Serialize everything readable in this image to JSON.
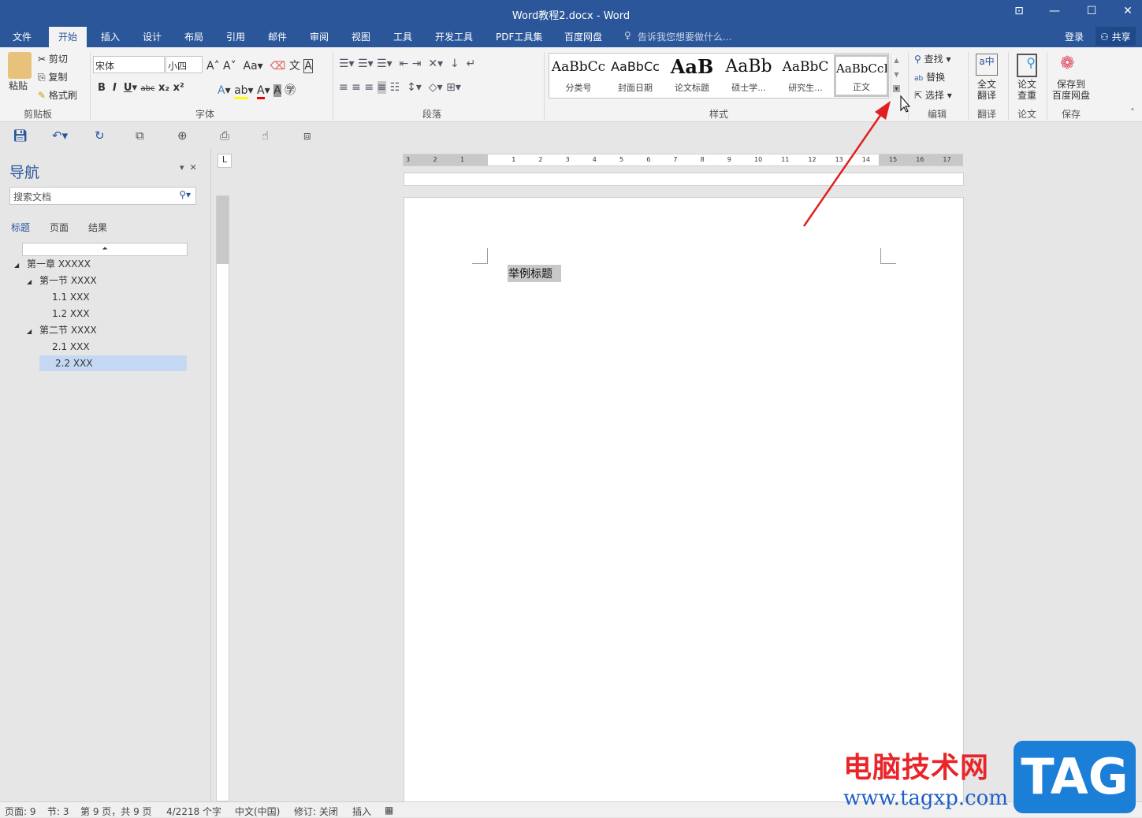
{
  "window": {
    "title": "Word教程2.docx - Word",
    "controls": [
      "restore-ribbon",
      "minimize",
      "maximize",
      "close"
    ]
  },
  "tabs": [
    "文件",
    "开始",
    "插入",
    "设计",
    "布局",
    "引用",
    "邮件",
    "审阅",
    "视图",
    "工具",
    "开发工具",
    "PDF工具集",
    "百度网盘"
  ],
  "active_tab": "开始",
  "tell_me": "告诉我您想要做什么...",
  "login": "登录",
  "share": "共享",
  "ribbon": {
    "clipboard": {
      "paste": "粘贴",
      "cut": "剪切",
      "copy": "复制",
      "format_painter": "格式刷",
      "group": "剪贴板"
    },
    "font": {
      "font_name": "宋体",
      "font_size": "小四",
      "group": "字体"
    },
    "paragraph": {
      "group": "段落"
    },
    "styles": {
      "items": [
        {
          "sample": "AaBbCc",
          "label": "分类号"
        },
        {
          "sample": "AaBbCc",
          "label": "封面日期"
        },
        {
          "sample": "AaB",
          "label": "论文标题"
        },
        {
          "sample": "AaBb",
          "label": "硕士学..."
        },
        {
          "sample": "AaBbC",
          "label": "研究生..."
        },
        {
          "sample": "AaBbCcI",
          "label": "正文"
        }
      ],
      "group": "样式",
      "selected": "正文"
    },
    "editing": {
      "find": "查找",
      "replace": "替换",
      "select": "选择",
      "group": "编辑"
    },
    "translate": {
      "label1": "全文",
      "label2": "翻译",
      "group": "翻译"
    },
    "paper": {
      "label1": "论文",
      "label2": "查重",
      "group": "论文"
    },
    "save": {
      "label1": "保存到",
      "label2": "百度网盘",
      "group": "保存"
    }
  },
  "nav": {
    "title": "导航",
    "search_placeholder": "搜索文档",
    "tabs": [
      "标题",
      "页面",
      "结果"
    ],
    "active_tab": "标题",
    "tree": [
      {
        "text": "第一章 XXXXX",
        "level": 0,
        "expanded": true
      },
      {
        "text": "第一节 XXXX",
        "level": 1,
        "expanded": true
      },
      {
        "text": "1.1 XXX",
        "level": 2
      },
      {
        "text": "1.2 XXX",
        "level": 2
      },
      {
        "text": "第二节 XXXX",
        "level": 1,
        "expanded": true
      },
      {
        "text": "2.1 XXX",
        "level": 2
      },
      {
        "text": "2.2 XXX",
        "level": 2,
        "selected": true
      }
    ]
  },
  "ruler": {
    "h_ticks": [
      "3",
      "2",
      "1",
      "1",
      "2",
      "3",
      "4",
      "5",
      "6",
      "7",
      "8",
      "9",
      "10",
      "11",
      "12",
      "13",
      "14",
      "15",
      "16",
      "17"
    ],
    "tab_selector": "L"
  },
  "document": {
    "heading": "举例标题"
  },
  "status": {
    "page": "页面: 9",
    "section": "节: 3",
    "pages": "第 9 页，共 9 页",
    "words": "4/2218 个字",
    "language": "中文(中国)",
    "track": "修订: 关闭",
    "mode": "插入"
  },
  "watermark": {
    "site_name": "电脑技术网",
    "url": "www.tagxp.com",
    "logo": "TAG"
  },
  "colors": {
    "brand": "#2b579a",
    "arrow": "#e02020",
    "selected_tree": "#c5d8f3"
  }
}
